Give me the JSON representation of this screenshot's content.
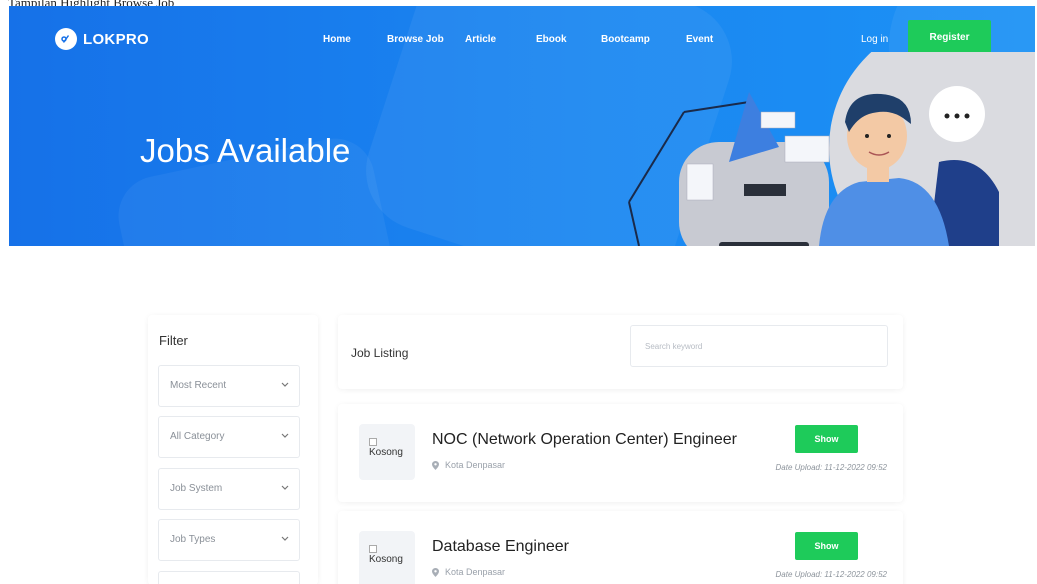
{
  "caption": "Tampilan Highlight Browse Job",
  "brand": {
    "name": "LOKPRO",
    "accent": "#1a86f1",
    "green": "#1ecb5a"
  },
  "nav": {
    "items": [
      "Home",
      "Browse Job",
      "Article",
      "Ebook",
      "Bootcamp",
      "Event"
    ],
    "login": "Log in",
    "register": "Register"
  },
  "hero": {
    "title": "Jobs Available"
  },
  "filter": {
    "title": "Filter",
    "selects": [
      "Most Recent",
      "All Category",
      "Job System",
      "Job Types",
      ""
    ]
  },
  "listing": {
    "title": "Job Listing",
    "search_placeholder": "Search keyword"
  },
  "jobs": [
    {
      "logo_alt": "Kosong",
      "title": "NOC (Network Operation Center) Engineer",
      "location": "Kota Denpasar",
      "action": "Show",
      "date": "Date Upload: 11-12-2022 09:52"
    },
    {
      "logo_alt": "Kosong",
      "title": "Database Engineer",
      "location": "Kota Denpasar",
      "action": "Show",
      "date": "Date Upload: 11-12-2022 09:52"
    }
  ]
}
